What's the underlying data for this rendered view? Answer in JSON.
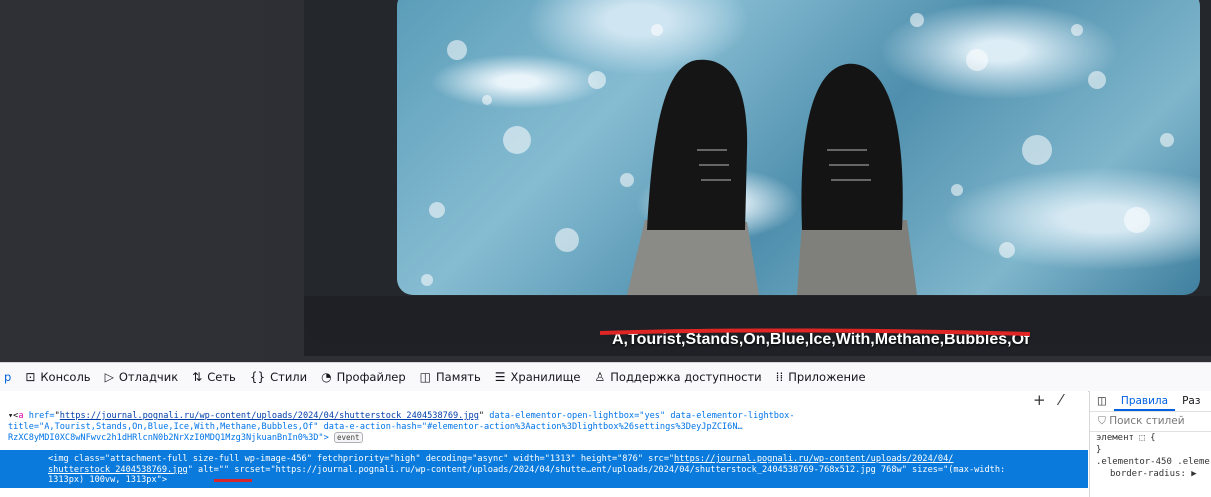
{
  "viewport": {
    "caption": "A,Tourist,Stands,On,Blue,Ice,With,Methane,Bubbles,Of"
  },
  "devtools": {
    "tabs": [
      {
        "label": "р",
        "icon": "inspector-icon",
        "selected": true
      },
      {
        "label": "Консоль",
        "icon": "console-icon"
      },
      {
        "label": "Отладчик",
        "icon": "debugger-icon"
      },
      {
        "label": "Сеть",
        "icon": "network-icon"
      },
      {
        "label": "Стили",
        "icon": "style-editor-icon"
      },
      {
        "label": "Профайлер",
        "icon": "profiler-icon"
      },
      {
        "label": "Память",
        "icon": "memory-icon"
      },
      {
        "label": "Хранилище",
        "icon": "storage-icon"
      },
      {
        "label": "Поддержка доступности",
        "icon": "accessibility-icon"
      },
      {
        "label": "Приложение",
        "icon": "application-icon"
      }
    ],
    "toolbar": {
      "add_label": "+",
      "pick_label": "⁄"
    }
  },
  "markup": {
    "a_line1_pre": "▾<",
    "a_tag": "a",
    "a_href_attr": " href=",
    "a_href": "https://journal.pognali.ru/wp-content/uploads/2024/04/shutterstock_2404538769.jpg",
    "a_line1_rest": " data-elementor-open-lightbox=\"yes\" data-elementor-lightbox-",
    "a_line2": "title=\"A,Tourist,Stands,On,Blue,Ice,With,Methane,Bubbles,Of\" data-e-action-hash=\"#elementor-action%3Aaction%3Dlightbox%26settings%3DeyJpZCI6N…",
    "a_line3": "RzXC8yMDI0XC8wNFwvc2h1dHRlcnN0b2NrXzI0MDQ1Mzg3NjkuanBnIn0%3D\">",
    "event_badge": "event",
    "img_line1_pre": "<img class=\"attachment-full size-full wp-image-456\" fetchpriority=\"high\" decoding=\"async\" width=\"1313\" height=\"876\" src=\"",
    "img_src_a": "https://journal.pognali.ru/wp-content/uploads/2024/04/",
    "img_src_b": "shutterstock_2404538769.jpg",
    "img_line2_mid": "\" alt=\"\" srcset=\"https://journal.pognali.ru/wp-content/uploads/2024/04/shutte…ent/uploads/2024/04/shutterstock_2404538769-768x512.jpg 768w\" sizes=\"(max-width:",
    "img_line3": "1313px) 100vw, 1313px\">"
  },
  "rules": {
    "tab_rules": "Правила",
    "tab_layout": "Раз",
    "search_placeholder": "Поиск стилей",
    "element_rule": "элемент ⬚ {",
    "close_brace": "}",
    "selector": ".elementor-450 .eleme",
    "property": "border-radius: ▶"
  }
}
